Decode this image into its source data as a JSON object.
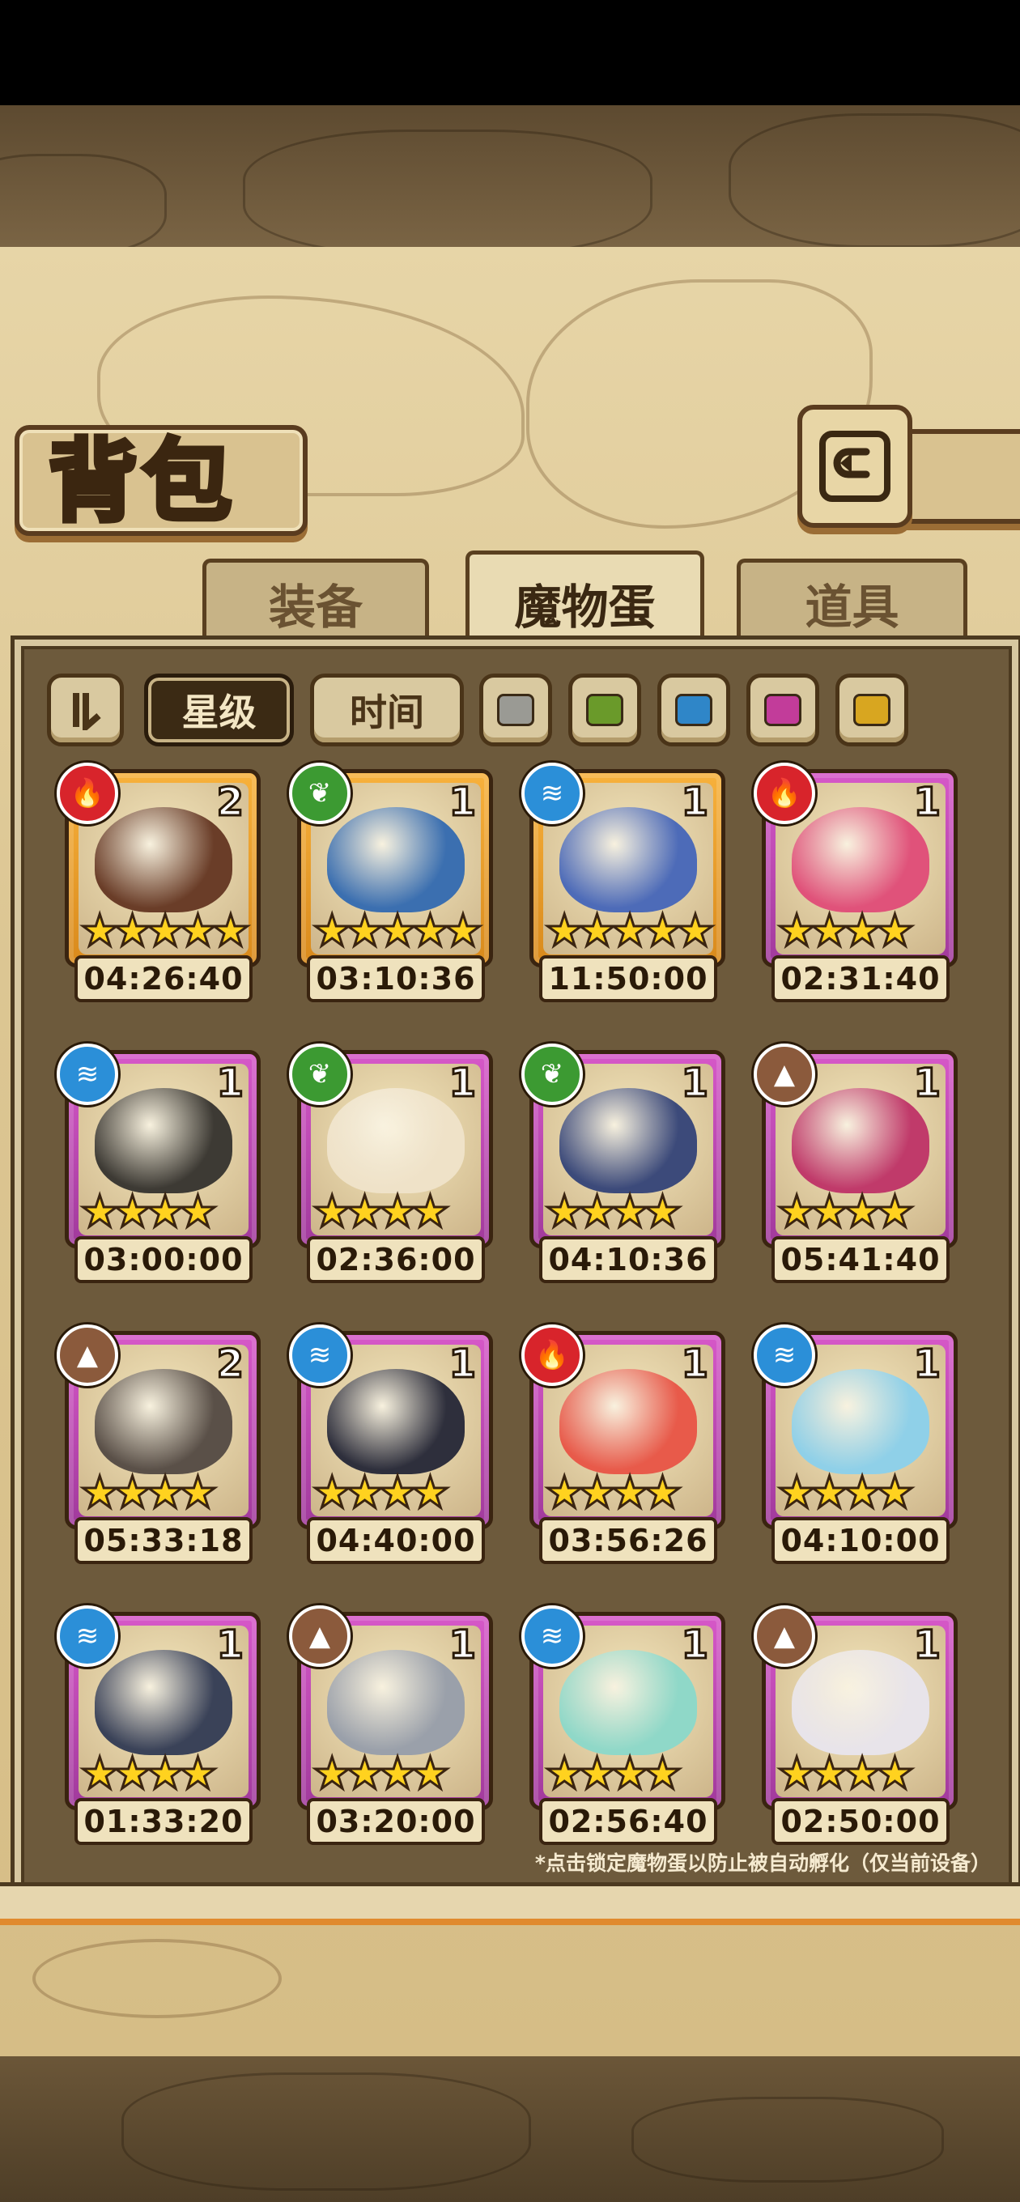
{
  "header": {
    "title": "背包",
    "back_icon": "return-arrow-icon"
  },
  "tabs": [
    {
      "label": "装备",
      "active": false
    },
    {
      "label": "魔物蛋",
      "active": true
    },
    {
      "label": "道具",
      "active": false
    }
  ],
  "filters": {
    "sort_label": "星级",
    "time_label": "时间",
    "colors": [
      "#9a9a94",
      "#6a9a2a",
      "#2f86c8",
      "#c23c9a",
      "#d8a620"
    ]
  },
  "eggs": [
    {
      "element": "fire",
      "count": "2",
      "stars": 5,
      "rarity": "gold",
      "timer": "04:26:40",
      "art": "#6a3d28"
    },
    {
      "element": "leaf",
      "count": "1",
      "stars": 5,
      "rarity": "gold",
      "timer": "03:10:36",
      "art": "#3b6fb0"
    },
    {
      "element": "water",
      "count": "1",
      "stars": 5,
      "rarity": "gold",
      "timer": "11:50:00",
      "art": "#4d6bb8"
    },
    {
      "element": "fire",
      "count": "1",
      "stars": 4,
      "rarity": "purple",
      "timer": "02:31:40",
      "art": "#e0527a"
    },
    {
      "element": "water",
      "count": "1",
      "stars": 4,
      "rarity": "purple",
      "timer": "03:00:00",
      "art": "#3d3a34"
    },
    {
      "element": "leaf",
      "count": "1",
      "stars": 4,
      "rarity": "purple",
      "timer": "02:36:00",
      "art": "#efe2c8"
    },
    {
      "element": "leaf",
      "count": "1",
      "stars": 4,
      "rarity": "purple",
      "timer": "04:10:36",
      "art": "#3c4a7a"
    },
    {
      "element": "earth",
      "count": "1",
      "stars": 4,
      "rarity": "purple",
      "timer": "05:41:40",
      "art": "#c03a6a"
    },
    {
      "element": "earth",
      "count": "2",
      "stars": 4,
      "rarity": "purple",
      "timer": "05:33:18",
      "art": "#5a5048"
    },
    {
      "element": "water",
      "count": "1",
      "stars": 4,
      "rarity": "purple",
      "timer": "04:40:00",
      "art": "#2e2f3c"
    },
    {
      "element": "fire",
      "count": "1",
      "stars": 4,
      "rarity": "purple",
      "timer": "03:56:26",
      "art": "#e85a4a"
    },
    {
      "element": "water",
      "count": "1",
      "stars": 4,
      "rarity": "purple",
      "timer": "04:10:00",
      "art": "#8fd0e8"
    },
    {
      "element": "water",
      "count": "1",
      "stars": 4,
      "rarity": "purple",
      "timer": "01:33:20",
      "art": "#3a4258"
    },
    {
      "element": "earth",
      "count": "1",
      "stars": 4,
      "rarity": "purple",
      "timer": "03:20:00",
      "art": "#9aa0aa"
    },
    {
      "element": "water",
      "count": "1",
      "stars": 4,
      "rarity": "purple",
      "timer": "02:56:40",
      "art": "#8fd8c8"
    },
    {
      "element": "earth",
      "count": "1",
      "stars": 4,
      "rarity": "purple",
      "timer": "02:50:00",
      "art": "#e8e4ea"
    }
  ],
  "footnote": "*点击锁定魔物蛋以防止被自动孵化（仅当前设备）"
}
